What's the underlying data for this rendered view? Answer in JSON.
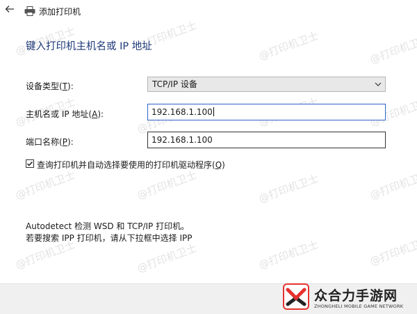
{
  "window": {
    "title": "添加打印机",
    "back_icon": "arrow-left-icon",
    "printer_icon": "printer-icon"
  },
  "heading": "键入打印机主机名或 IP 地址",
  "form": {
    "device_type": {
      "label_prefix": "设备类型(",
      "label_key": "T",
      "label_suffix": "):",
      "value": "TCP/IP 设备"
    },
    "host": {
      "label_prefix": "主机名或 IP 地址(",
      "label_key": "A",
      "label_suffix": "):",
      "value": "192.168.1.100"
    },
    "port": {
      "label_prefix": "端口名称(",
      "label_key": "P",
      "label_suffix": "):",
      "value": "192.168.1.100"
    },
    "auto_driver": {
      "checked": true,
      "label_prefix": "查询打印机并自动选择要使用的打印机驱动程序(",
      "label_key": "Q",
      "label_suffix": ")"
    }
  },
  "info": {
    "line1": "Autodetect 检测 WSD 和 TCP/IP 打印机。",
    "line2": "若要搜索 IPP 打印机，请从下拉框中选择 IPP"
  },
  "watermark": "@打印机卫士",
  "brand": {
    "name_cn": "众合力手游网",
    "name_en": "ZHONGHELI MOBILE GAME NETWORK",
    "colors": {
      "red": "#e6312f",
      "text": "#222222"
    }
  }
}
